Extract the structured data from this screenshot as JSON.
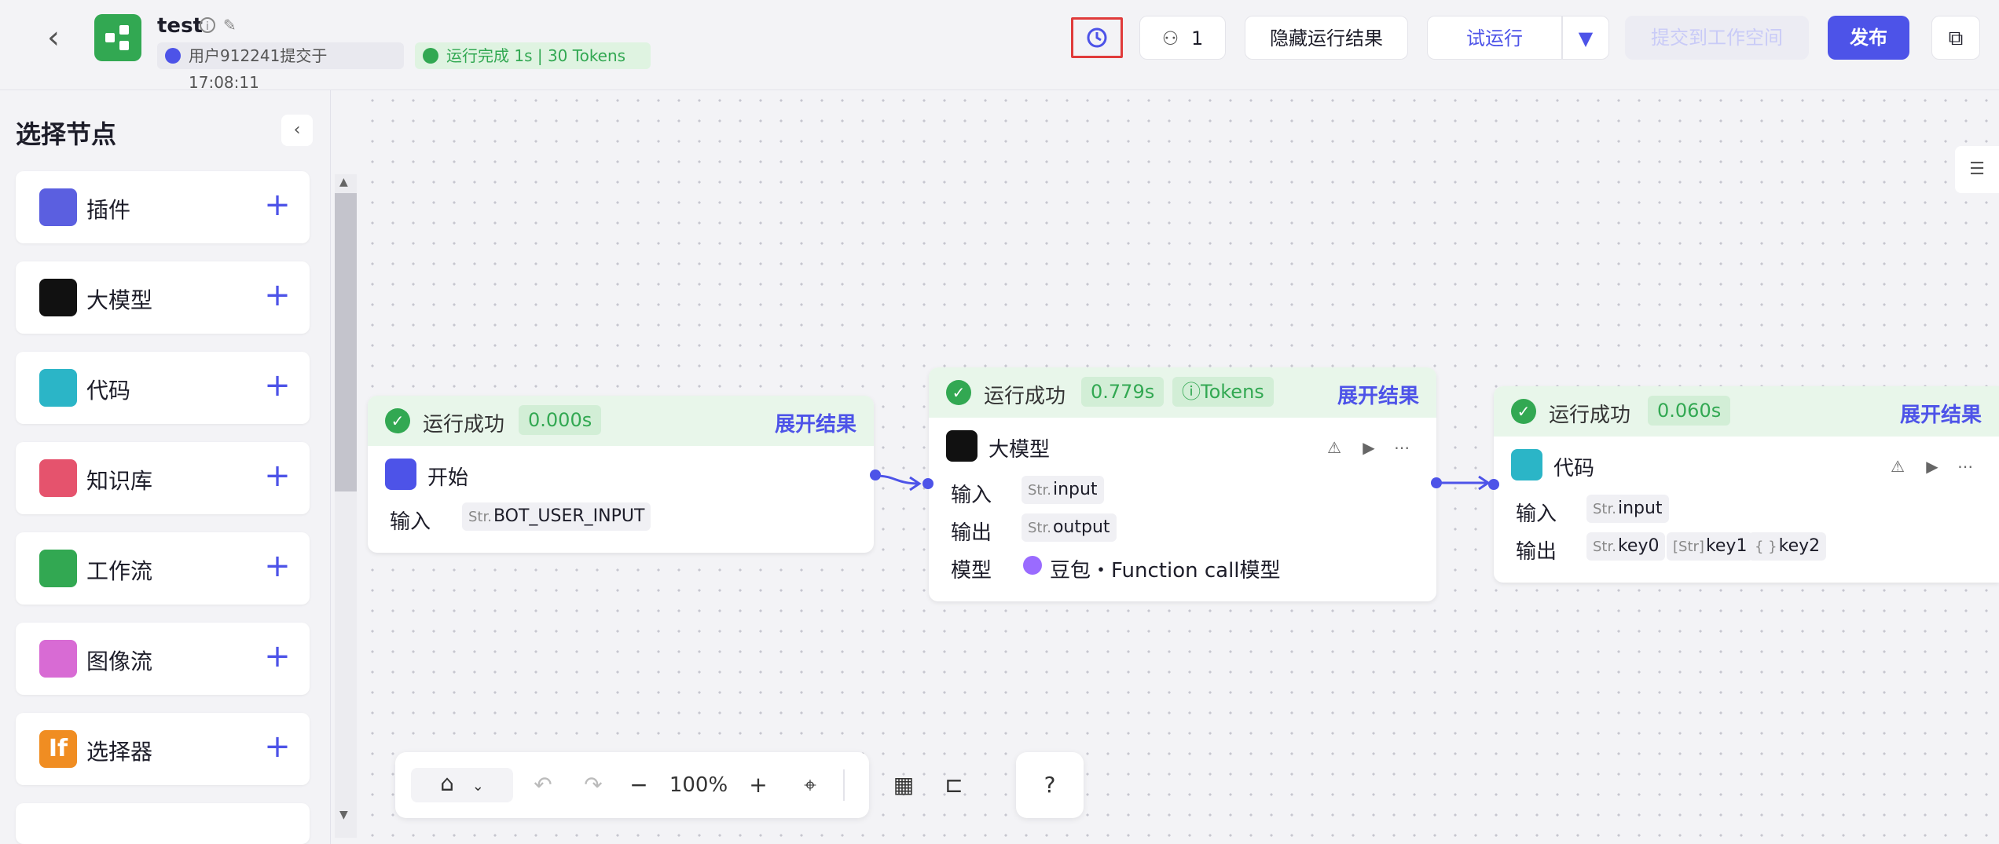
{
  "header": {
    "back_icon": "chevron-left-icon",
    "app_title": "test",
    "submit_info": "用户912241提交于17:08:11",
    "run_status": "运行完成 1s | 30 Tokens",
    "collab_count": "1",
    "hide_results_label": "隐藏运行结果",
    "test_run_label": "试运行",
    "submit_workspace_label": "提交到工作空间",
    "publish_label": "发布"
  },
  "sidebar": {
    "title": "选择节点",
    "items": [
      {
        "label": "插件",
        "icon": "plugin-icon",
        "color": "#5b5fe0"
      },
      {
        "label": "大模型",
        "icon": "llm-icon",
        "color": "#111111"
      },
      {
        "label": "代码",
        "icon": "code-icon",
        "color": "#2bb5c7"
      },
      {
        "label": "知识库",
        "icon": "knowledge-icon",
        "color": "#e5536d"
      },
      {
        "label": "工作流",
        "icon": "workflow-icon",
        "color": "#32a852"
      },
      {
        "label": "图像流",
        "icon": "imageflow-icon",
        "color": "#d86bd4"
      },
      {
        "label": "选择器",
        "icon": "selector-icon",
        "color": "#f08d22"
      }
    ]
  },
  "nodes": {
    "start": {
      "status": "运行成功",
      "time": "0.000s",
      "expand": "展开结果",
      "name": "开始",
      "input_label": "输入",
      "input_type": "Str.",
      "input_value": "BOT_USER_INPUT"
    },
    "llm": {
      "status": "运行成功",
      "time": "0.779s",
      "tokens": "ⓘTokens",
      "expand": "展开结果",
      "name": "大模型",
      "input_label": "输入",
      "input_type": "Str.",
      "input_value": "input",
      "output_label": "输出",
      "output_type": "Str.",
      "output_value": "output",
      "model_label": "模型",
      "model_value": "豆包・Function call模型"
    },
    "code": {
      "status": "运行成功",
      "time": "0.060s",
      "expand": "展开结果",
      "name": "代码",
      "input_label": "输入",
      "input_type": "Str.",
      "input_value": "input",
      "output_label": "输出",
      "outputs": [
        {
          "type": "Str.",
          "value": "key0"
        },
        {
          "type": "[Str]",
          "value": "key1"
        },
        {
          "type": "{ }",
          "value": "key2"
        }
      ]
    }
  },
  "toolbar": {
    "zoom": "100%"
  },
  "colors": {
    "accent": "#4d53e8",
    "success": "#32a852",
    "history_highlight": "#e03b3b"
  }
}
